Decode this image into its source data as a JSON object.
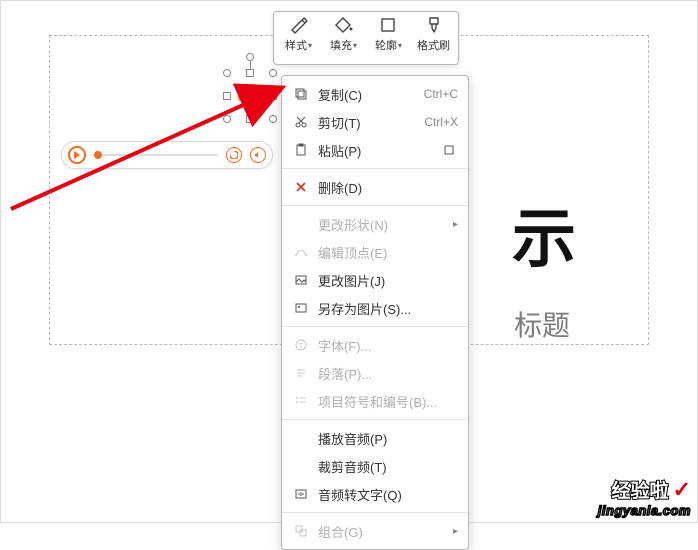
{
  "format_bar": {
    "style": "样式",
    "fill": "填充",
    "outline": "轮廓",
    "painter": "格式刷"
  },
  "slide": {
    "big_fragment": "示",
    "sub_fragment": "标题"
  },
  "context_menu": {
    "copy": {
      "label": "复制(C)",
      "shortcut": "Ctrl+C"
    },
    "cut": {
      "label": "剪切(T)",
      "shortcut": "Ctrl+X"
    },
    "paste": {
      "label": "粘贴(P)"
    },
    "delete": {
      "label": "删除(D)"
    },
    "change_shape": {
      "label": "更改形状(N)"
    },
    "edit_points": {
      "label": "编辑顶点(E)"
    },
    "change_pic": {
      "label": "更改图片(J)"
    },
    "save_as_pic": {
      "label": "另存为图片(S)..."
    },
    "font": {
      "label": "字体(F)..."
    },
    "paragraph": {
      "label": "段落(P)..."
    },
    "bullets": {
      "label": "项目符号和编号(B)..."
    },
    "play_audio": {
      "label": "播放音频(P)"
    },
    "trim_audio": {
      "label": "裁剪音频(T)"
    },
    "audio_to_text": {
      "label": "音频转文字(Q)"
    },
    "group": {
      "label": "组合(G)"
    }
  },
  "watermark": {
    "top": "经验啦",
    "bottom": "jingyanla.com"
  }
}
